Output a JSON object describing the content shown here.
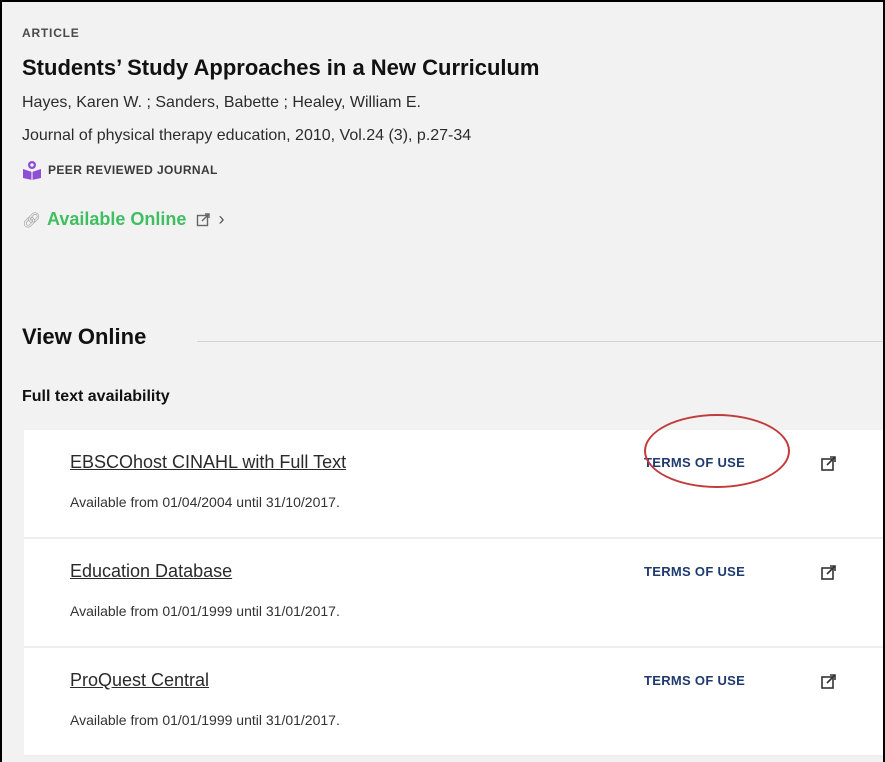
{
  "record": {
    "type_label": "ARTICLE",
    "title": "Students’ Study Approaches in a New Curriculum",
    "authors": "Hayes, Karen W. ; Sanders, Babette ; Healey, William E.",
    "journal": "Journal of physical therapy education, 2010, Vol.24 (3), p.27-34",
    "peer_reviewed": "PEER REVIEWED JOURNAL",
    "availability": "Available Online"
  },
  "view_online": {
    "heading": "View Online",
    "subheading": "Full text availability",
    "items": [
      {
        "name": "EBSCOhost CINAHL with Full Text",
        "range": "Available from 01/04/2004 until 31/10/2017.",
        "terms_label": "TERMS OF USE"
      },
      {
        "name": "Education Database",
        "range": "Available from 01/01/1999 until 31/01/2017.",
        "terms_label": "TERMS OF USE"
      },
      {
        "name": "ProQuest Central",
        "range": "Available from 01/01/1999 until 31/01/2017.",
        "terms_label": "TERMS OF USE"
      }
    ]
  },
  "colors": {
    "available": "#3fbf60",
    "terms": "#1e3a6e",
    "peer_icon": "#8e4fd6",
    "highlight": "#c23b3b"
  },
  "icons": {
    "peer": "book-reader-icon",
    "link": "link-icon",
    "external": "external-link-icon",
    "chevron": "chevron-right-icon"
  }
}
